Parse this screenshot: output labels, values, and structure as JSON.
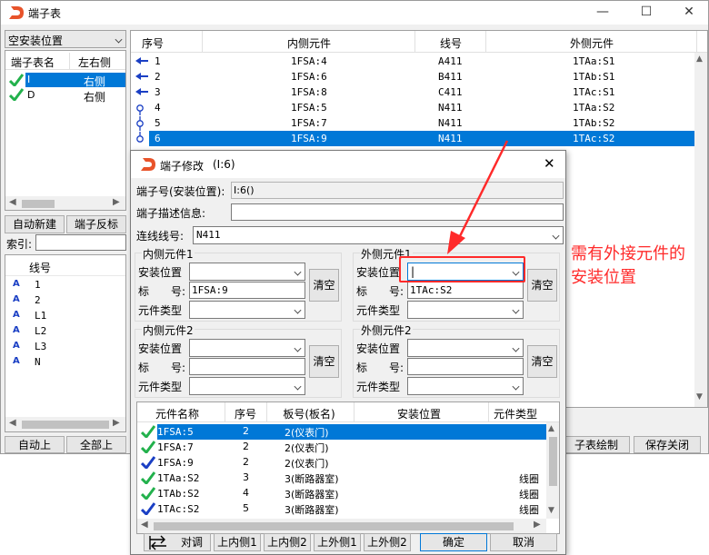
{
  "main": {
    "title": "端子表",
    "window_controls": {
      "minimize": "—",
      "maximize": "☐",
      "close": "✕"
    },
    "install_location_select": "空安装位置",
    "terminal_list": {
      "headers": [
        "端子表名",
        "左右侧"
      ],
      "items": [
        {
          "name": "I",
          "side": "右侧",
          "selected": true
        },
        {
          "name": "D",
          "side": "右侧",
          "selected": false
        }
      ]
    },
    "auto_create_button": "自动新建",
    "terminal_reverse_button": "端子反标",
    "index_label": "索引:",
    "index_value": "",
    "wire_list": {
      "header": "线号",
      "items": [
        "1",
        "2",
        "L1",
        "L2",
        "L3",
        "N"
      ]
    },
    "auto_up_button": "自动上",
    "all_up_button": "全部上",
    "draw_button": "子表绘制",
    "save_close_button": "保存关闭",
    "table": {
      "headers": [
        "序号",
        "内侧元件",
        "线号",
        "外侧元件"
      ],
      "rows": [
        {
          "no": "1",
          "inner": "1FSA:4",
          "wire": "A411",
          "outer": "1TAa:S1",
          "selected": false
        },
        {
          "no": "2",
          "inner": "1FSA:6",
          "wire": "B411",
          "outer": "1TAb:S1",
          "selected": false
        },
        {
          "no": "3",
          "inner": "1FSA:8",
          "wire": "C411",
          "outer": "1TAc:S1",
          "selected": false
        },
        {
          "no": "4",
          "inner": "1FSA:5",
          "wire": "N411",
          "outer": "1TAa:S2",
          "selected": false
        },
        {
          "no": "5",
          "inner": "1FSA:7",
          "wire": "N411",
          "outer": "1TAb:S2",
          "selected": false
        },
        {
          "no": "6",
          "inner": "1FSA:9",
          "wire": "N411",
          "outer": "1TAc:S2",
          "selected": true
        }
      ]
    }
  },
  "dialog": {
    "title": "端子修改",
    "title_suffix": "(I:6)",
    "close": "✕",
    "terminal_no_label": "端子号(安装位置):",
    "terminal_no_value": "I:6()",
    "description_label": "端子描述信息:",
    "description_value": "",
    "wire_no_label": "连线线号:",
    "wire_no_value": "N411",
    "inner1": {
      "title": "内侧元件1",
      "location_label": "安装位置",
      "location_value": "",
      "tag_label": "标　　号:",
      "tag_value": "1FSA:9",
      "type_label": "元件类型",
      "type_value": "",
      "clear_button": "清空"
    },
    "outer1": {
      "title": "外侧元件1",
      "location_label": "安装位置",
      "location_value": "|",
      "tag_label": "标　　号:",
      "tag_value": "1TAc:S2",
      "type_label": "元件类型",
      "type_value": "",
      "clear_button": "清空"
    },
    "inner2": {
      "title": "内侧元件2",
      "location_label": "安装位置",
      "location_value": "",
      "tag_label": "标　　号:",
      "tag_value": "",
      "type_label": "元件类型",
      "type_value": "",
      "clear_button": "清空"
    },
    "outer2": {
      "title": "外侧元件2",
      "location_label": "安装位置",
      "location_value": "",
      "tag_label": "标　　号:",
      "tag_value": "",
      "type_label": "元件类型",
      "type_value": "",
      "clear_button": "清空"
    },
    "component_table": {
      "headers": [
        "元件名称",
        "序号",
        "板号(板名)",
        "安装位置",
        "元件类型"
      ],
      "rows": [
        {
          "name": "1FSA:5",
          "no": "2",
          "board": "2(仪表门)",
          "location": "",
          "type": "",
          "selected": true,
          "check": "green"
        },
        {
          "name": "1FSA:7",
          "no": "2",
          "board": "2(仪表门)",
          "location": "",
          "type": "",
          "selected": false,
          "check": "green"
        },
        {
          "name": "1FSA:9",
          "no": "2",
          "board": "2(仪表门)",
          "location": "",
          "type": "",
          "selected": false,
          "check": "blue"
        },
        {
          "name": "1TAa:S2",
          "no": "3",
          "board": "3(断路器室)",
          "location": "",
          "type": "线圈",
          "selected": false,
          "check": "green"
        },
        {
          "name": "1TAb:S2",
          "no": "4",
          "board": "3(断路器室)",
          "location": "",
          "type": "线圈",
          "selected": false,
          "check": "green"
        },
        {
          "name": "1TAc:S2",
          "no": "5",
          "board": "3(断路器室)",
          "location": "",
          "type": "线圈",
          "selected": false,
          "check": "blue"
        }
      ]
    },
    "buttons": {
      "swap": "对调",
      "up_inner1": "上内侧1",
      "up_inner2": "上内侧2",
      "up_outer1": "上外侧1",
      "up_outer2": "上外侧2",
      "ok": "确定",
      "cancel": "取消"
    }
  },
  "annotation": {
    "text": "需有外接元件的安装位置",
    "color": "#ff2a2a"
  }
}
